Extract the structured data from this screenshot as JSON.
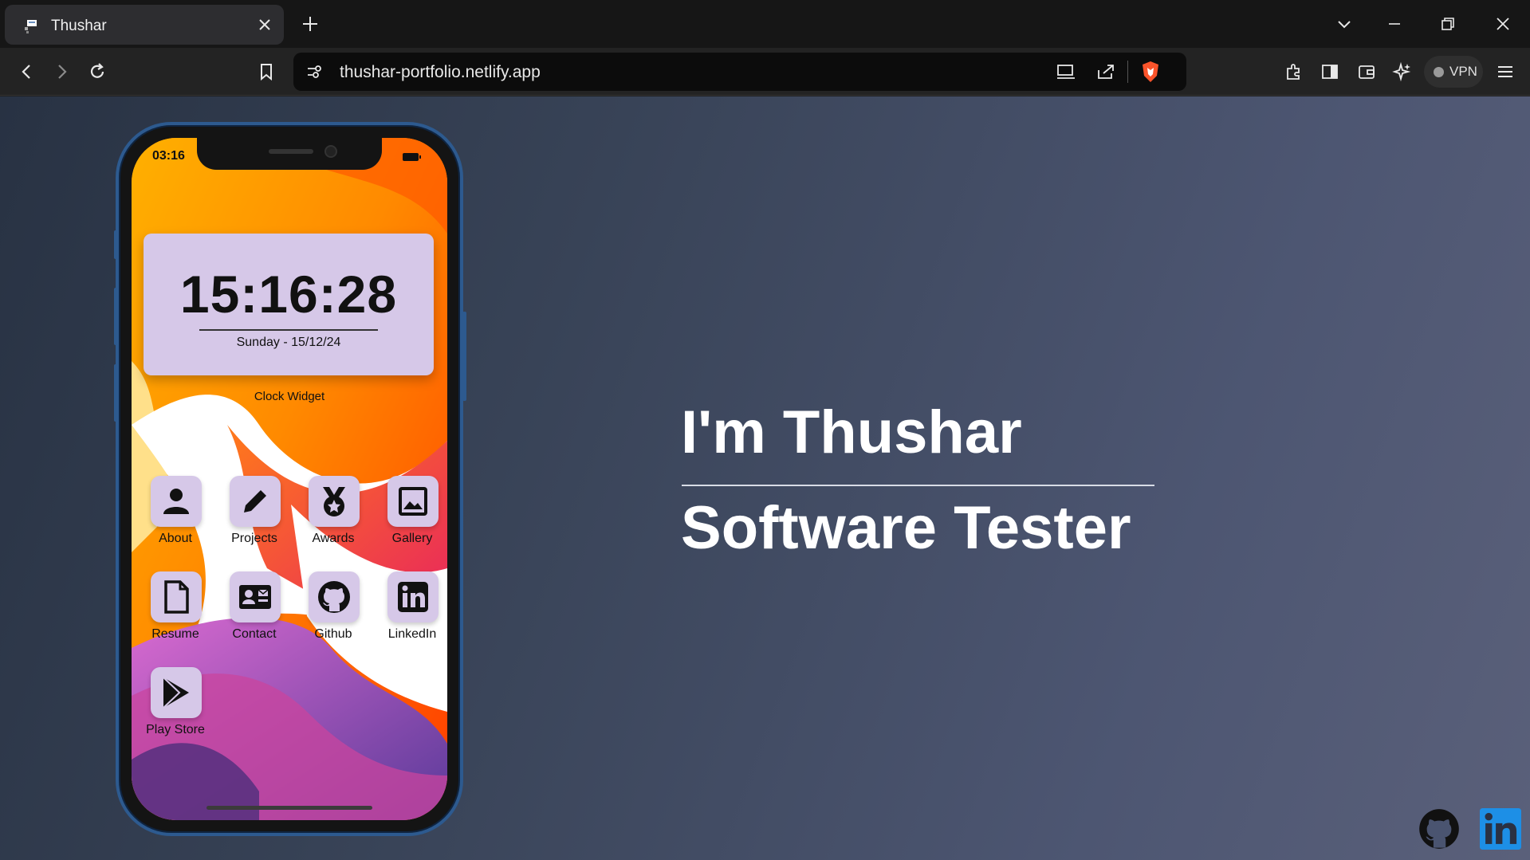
{
  "browser": {
    "tab": {
      "title": "Thushar"
    },
    "url": "thushar-portfolio.netlify.app",
    "vpn_label": "VPN"
  },
  "phone": {
    "status_time": "03:16",
    "clock": {
      "time": "15:16:28",
      "date": "Sunday - 15/12/24",
      "widget_label": "Clock Widget"
    },
    "apps": [
      {
        "label": "About",
        "icon": "person-icon"
      },
      {
        "label": "Projects",
        "icon": "pencil-icon"
      },
      {
        "label": "Awards",
        "icon": "medal-icon"
      },
      {
        "label": "Gallery",
        "icon": "image-icon"
      },
      {
        "label": "Resume",
        "icon": "document-icon"
      },
      {
        "label": "Contact",
        "icon": "contact-card-icon"
      },
      {
        "label": "Github",
        "icon": "github-icon"
      },
      {
        "label": "LinkedIn",
        "icon": "linkedin-icon"
      },
      {
        "label": "Play Store",
        "icon": "play-store-icon"
      }
    ]
  },
  "hero": {
    "name": "I'm Thushar",
    "role": "Software Tester"
  },
  "colors": {
    "app_tile": "#d6c8e8",
    "phone_frame": "#2d5a8f",
    "linkedin": "#1d8fe6"
  }
}
